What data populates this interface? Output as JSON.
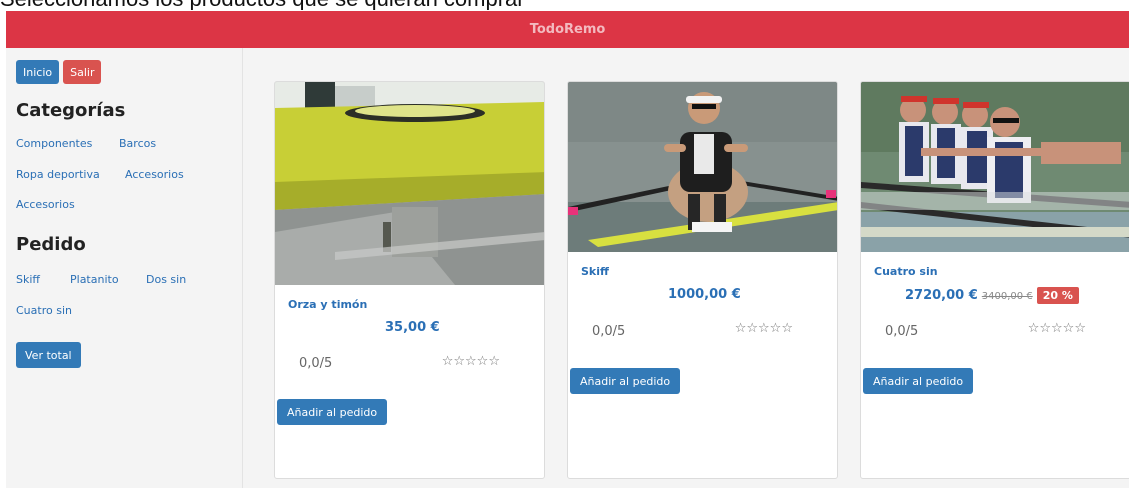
{
  "caption": "Seleccionamos los productos que se quieran comprar",
  "header": {
    "title": "TodoRemo"
  },
  "sidebar": {
    "inicio_label": "Inicio",
    "salir_label": "Salir",
    "categorias_title": "Categorías",
    "categorias": [
      "Componentes",
      "Barcos",
      "Ropa deportiva",
      "Accesorios",
      "Accesorios"
    ],
    "pedido_title": "Pedido",
    "pedido_items": [
      "Skiff",
      "Platanito",
      "Dos sin",
      "Cuatro sin"
    ],
    "ver_total_label": "Ver total"
  },
  "products": [
    {
      "name": "Orza y timón",
      "price": "35,00 €",
      "rating": "0,0/5",
      "stars": "☆☆☆☆☆",
      "stars_value": 0,
      "add_label": "Añadir al pedido"
    },
    {
      "name": "Skiff",
      "price": "1000,00 €",
      "rating": "0,0/5",
      "stars": "☆☆☆☆☆",
      "stars_value": 0,
      "add_label": "Añadir al pedido"
    },
    {
      "name": "Cuatro sin",
      "price": "2720,00 €",
      "old_price": "3400,00 €",
      "discount": "20 %",
      "rating": "0,0/5",
      "stars": "☆☆☆☆☆",
      "stars_value": 0,
      "add_label": "Añadir al pedido"
    }
  ],
  "colors": {
    "header": "#dc3545",
    "primary": "#337ab7",
    "danger": "#d9534f",
    "link": "#2a6fb5"
  }
}
